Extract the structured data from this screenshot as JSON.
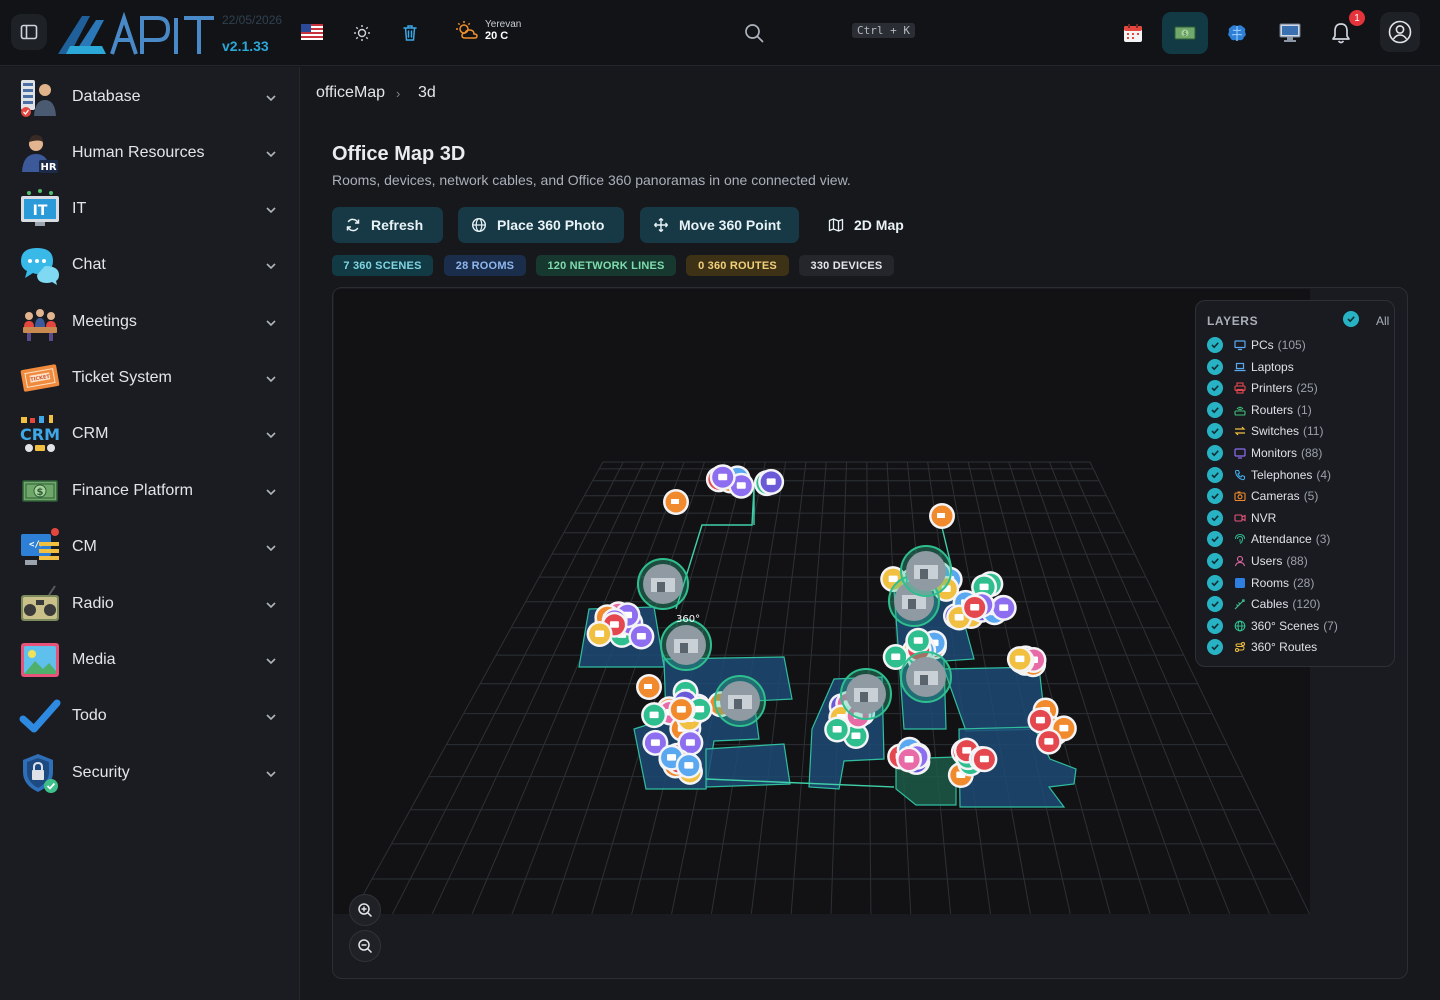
{
  "app": {
    "version": "v2.1.33",
    "date": "22/05/2026",
    "weather": {
      "city": "Yerevan",
      "temp": "20 C"
    },
    "search_shortcut": "Ctrl + K",
    "notification_count": "1"
  },
  "sidebar": {
    "items": [
      {
        "label": "Database",
        "icon": "database-icon"
      },
      {
        "label": "Human Resources",
        "icon": "hr-icon"
      },
      {
        "label": "IT",
        "icon": "it-icon"
      },
      {
        "label": "Chat",
        "icon": "chat-icon"
      },
      {
        "label": "Meetings",
        "icon": "meetings-icon"
      },
      {
        "label": "Ticket System",
        "icon": "ticket-icon"
      },
      {
        "label": "CRM",
        "icon": "crm-icon"
      },
      {
        "label": "Finance Platform",
        "icon": "finance-icon"
      },
      {
        "label": "CM",
        "icon": "cm-icon"
      },
      {
        "label": "Radio",
        "icon": "radio-icon"
      },
      {
        "label": "Media",
        "icon": "media-icon"
      },
      {
        "label": "Todo",
        "icon": "todo-icon"
      },
      {
        "label": "Security",
        "icon": "security-icon"
      }
    ]
  },
  "breadcrumb": {
    "root": "officeMap",
    "separator": "›",
    "current": "3d"
  },
  "page": {
    "title": "Office Map 3D",
    "subtitle": "Rooms, devices, network cables, and Office 360 panoramas in one connected view."
  },
  "actions": {
    "refresh": "Refresh",
    "place_photo": "Place 360 Photo",
    "move_point": "Move 360 Point",
    "map_2d": "2D Map"
  },
  "stats": {
    "scenes": "7 360 SCENES",
    "rooms": "28 ROOMS",
    "network_lines": "120 NETWORK LINES",
    "routes": "0 360 ROUTES",
    "devices": "330 DEVICES"
  },
  "map": {
    "marker_label": "360°"
  },
  "layers": {
    "title": "LAYERS",
    "all_label": "All",
    "items": [
      {
        "name": "PCs",
        "count": "(105)",
        "color": "#5aa9f0"
      },
      {
        "name": "Laptops",
        "count": "",
        "color": "#5aa9f0"
      },
      {
        "name": "Printers",
        "count": "(25)",
        "color": "#e5474f"
      },
      {
        "name": "Routers",
        "count": "(1)",
        "color": "#3fbf78"
      },
      {
        "name": "Switches",
        "count": "(11)",
        "color": "#f2c040"
      },
      {
        "name": "Monitors",
        "count": "(88)",
        "color": "#8d6ef0"
      },
      {
        "name": "Telephones",
        "count": "(4)",
        "color": "#3fa8e8"
      },
      {
        "name": "Cameras",
        "count": "(5)",
        "color": "#f08a2c"
      },
      {
        "name": "NVR",
        "count": "",
        "color": "#e8537a"
      },
      {
        "name": "Attendance",
        "count": "(3)",
        "color": "#2fbf8f"
      },
      {
        "name": "Users",
        "count": "(88)",
        "color": "#e86aa6"
      },
      {
        "name": "Rooms",
        "count": "(28)",
        "color": "#2f7fe0"
      },
      {
        "name": "Cables",
        "count": "(120)",
        "color": "#3fbf8f"
      },
      {
        "name": "360° Scenes",
        "count": "(7)",
        "color": "#2fbf8f"
      },
      {
        "name": "360° Routes",
        "count": "",
        "color": "#f2c040"
      }
    ]
  }
}
